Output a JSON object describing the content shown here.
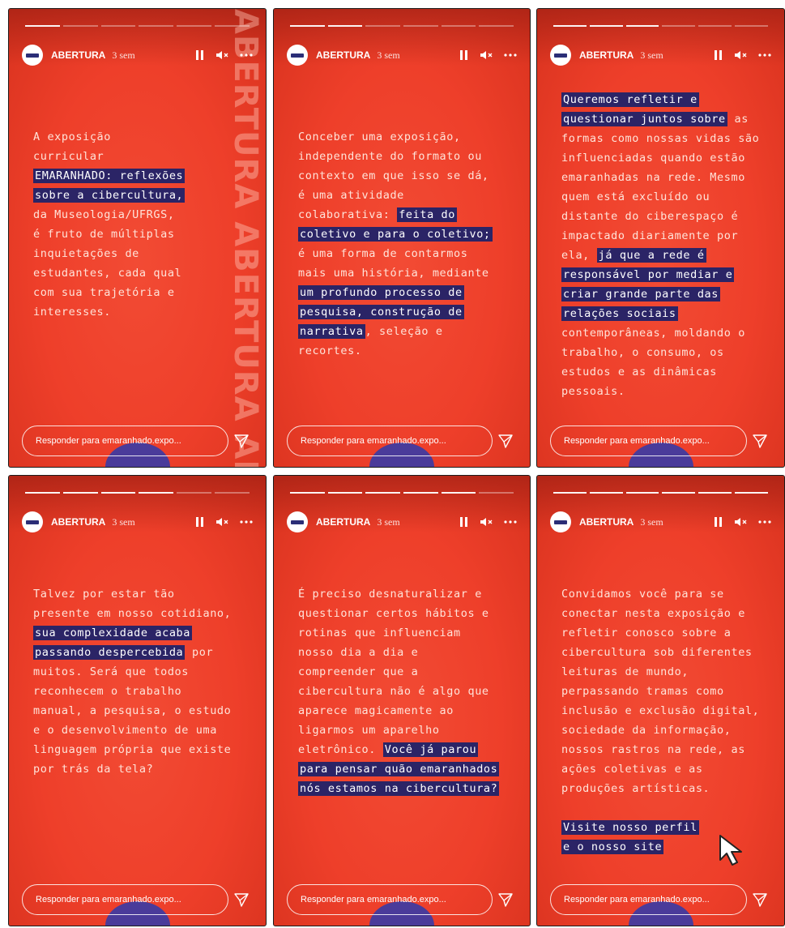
{
  "account": "ABERTURA",
  "time": "3 sem",
  "reply_placeholder": "Responder para emaranhado.expo...",
  "vertical_text": "ABERTURA ABERTURA ABERTURA",
  "colors": {
    "background": "#ee3f2a",
    "highlight": "#2b2466",
    "text": "#ffe3d9"
  },
  "icons": [
    "pause-icon",
    "mute-icon",
    "more-icon",
    "send-icon",
    "cursor-icon"
  ],
  "stories": [
    {
      "lines": [
        [
          {
            "t": "A exposição"
          }
        ],
        [
          {
            "t": "curricular"
          }
        ],
        [
          {
            "t": "EMARANHADO: reflexões",
            "h": true
          }
        ],
        [
          {
            "t": "sobre a cibercultura,",
            "h": true
          }
        ],
        [
          {
            "t": "da Museologia/UFRGS,"
          }
        ],
        [
          {
            "t": "é fruto de múltiplas"
          }
        ],
        [
          {
            "t": "inquietações de"
          }
        ],
        [
          {
            "t": "estudantes, cada qual"
          }
        ],
        [
          {
            "t": "com sua trajetória e"
          }
        ],
        [
          {
            "t": "interesses."
          }
        ]
      ]
    },
    {
      "lines": [
        [
          {
            "t": "Conceber uma exposição,"
          }
        ],
        [
          {
            "t": "independente do formato ou"
          }
        ],
        [
          {
            "t": "contexto em que isso se dá,"
          }
        ],
        [
          {
            "t": "é uma atividade"
          }
        ],
        [
          {
            "t": "colaborativa: "
          },
          {
            "t": "feita do",
            "h": true
          }
        ],
        [
          {
            "t": "coletivo e para o coletivo;",
            "h": true
          }
        ],
        [
          {
            "t": "é uma forma de contarmos"
          }
        ],
        [
          {
            "t": "mais uma história, mediante"
          }
        ],
        [
          {
            "t": "um profundo processo de",
            "h": true
          }
        ],
        [
          {
            "t": "pesquisa, construção de",
            "h": true
          }
        ],
        [
          {
            "t": "narrativa",
            "h": true
          },
          {
            "t": ", seleção e"
          }
        ],
        [
          {
            "t": "recortes."
          }
        ]
      ]
    },
    {
      "lines": [
        [
          {
            "t": "Queremos refletir e",
            "h": true
          }
        ],
        [
          {
            "t": "questionar juntos sobre",
            "h": true
          },
          {
            "t": " as"
          }
        ],
        [
          {
            "t": "formas como nossas vidas são"
          }
        ],
        [
          {
            "t": "influenciadas quando estão"
          }
        ],
        [
          {
            "t": "emaranhadas na rede. Mesmo"
          }
        ],
        [
          {
            "t": "quem está excluído ou"
          }
        ],
        [
          {
            "t": "distante do ciberespaço é"
          }
        ],
        [
          {
            "t": "impactado diariamente por"
          }
        ],
        [
          {
            "t": "ela, "
          },
          {
            "t": "já que a rede é",
            "h": true
          }
        ],
        [
          {
            "t": "responsável por mediar e",
            "h": true
          }
        ],
        [
          {
            "t": "criar grande parte das",
            "h": true
          }
        ],
        [
          {
            "t": "relações sociais",
            "h": true
          }
        ],
        [
          {
            "t": "contemporâneas, moldando o"
          }
        ],
        [
          {
            "t": "trabalho, o consumo, os"
          }
        ],
        [
          {
            "t": "estudos e as dinâmicas"
          }
        ],
        [
          {
            "t": "pessoais."
          }
        ]
      ]
    },
    {
      "lines": [
        [
          {
            "t": "Talvez por estar tão"
          }
        ],
        [
          {
            "t": "presente em nosso cotidiano,"
          }
        ],
        [
          {
            "t": "sua complexidade acaba",
            "h": true
          }
        ],
        [
          {
            "t": "passando despercebida",
            "h": true
          },
          {
            "t": " por"
          }
        ],
        [
          {
            "t": "muitos. Será que todos"
          }
        ],
        [
          {
            "t": "reconhecem o trabalho"
          }
        ],
        [
          {
            "t": "manual, a pesquisa, o estudo"
          }
        ],
        [
          {
            "t": "e o desenvolvimento de uma"
          }
        ],
        [
          {
            "t": "linguagem própria que existe"
          }
        ],
        [
          {
            "t": "por trás da tela?"
          }
        ]
      ]
    },
    {
      "lines": [
        [
          {
            "t": "É preciso desnaturalizar e"
          }
        ],
        [
          {
            "t": "questionar certos hábitos e"
          }
        ],
        [
          {
            "t": "rotinas que influenciam"
          }
        ],
        [
          {
            "t": "nosso dia a dia e"
          }
        ],
        [
          {
            "t": "compreender que a"
          }
        ],
        [
          {
            "t": "cibercultura não é algo que"
          }
        ],
        [
          {
            "t": "aparece magicamente ao"
          }
        ],
        [
          {
            "t": "ligarmos um aparelho"
          }
        ],
        [
          {
            "t": "eletrônico. "
          },
          {
            "t": "Você já parou",
            "h": true
          }
        ],
        [
          {
            "t": "para pensar quão emaranhados",
            "h": true
          }
        ],
        [
          {
            "t": "nós estamos na cibercultura?",
            "h": true
          }
        ]
      ]
    },
    {
      "lines": [
        [
          {
            "t": "Convidamos você para se"
          }
        ],
        [
          {
            "t": "conectar nesta exposição e"
          }
        ],
        [
          {
            "t": "refletir conosco sobre a"
          }
        ],
        [
          {
            "t": "cibercultura sob diferentes"
          }
        ],
        [
          {
            "t": "leituras de mundo,"
          }
        ],
        [
          {
            "t": "perpassando tramas como"
          }
        ],
        [
          {
            "t": "inclusão e exclusão digital,"
          }
        ],
        [
          {
            "t": "sociedade da informação,"
          }
        ],
        [
          {
            "t": "nossos rastros na rede, as"
          }
        ],
        [
          {
            "t": "ações coletivas e as"
          }
        ],
        [
          {
            "t": "produções artísticas."
          }
        ],
        [
          {
            "t": ""
          }
        ],
        [
          {
            "t": "Visite nosso perfil",
            "h": true
          }
        ],
        [
          {
            "t": "e o nosso site",
            "h": true
          }
        ]
      ]
    }
  ]
}
